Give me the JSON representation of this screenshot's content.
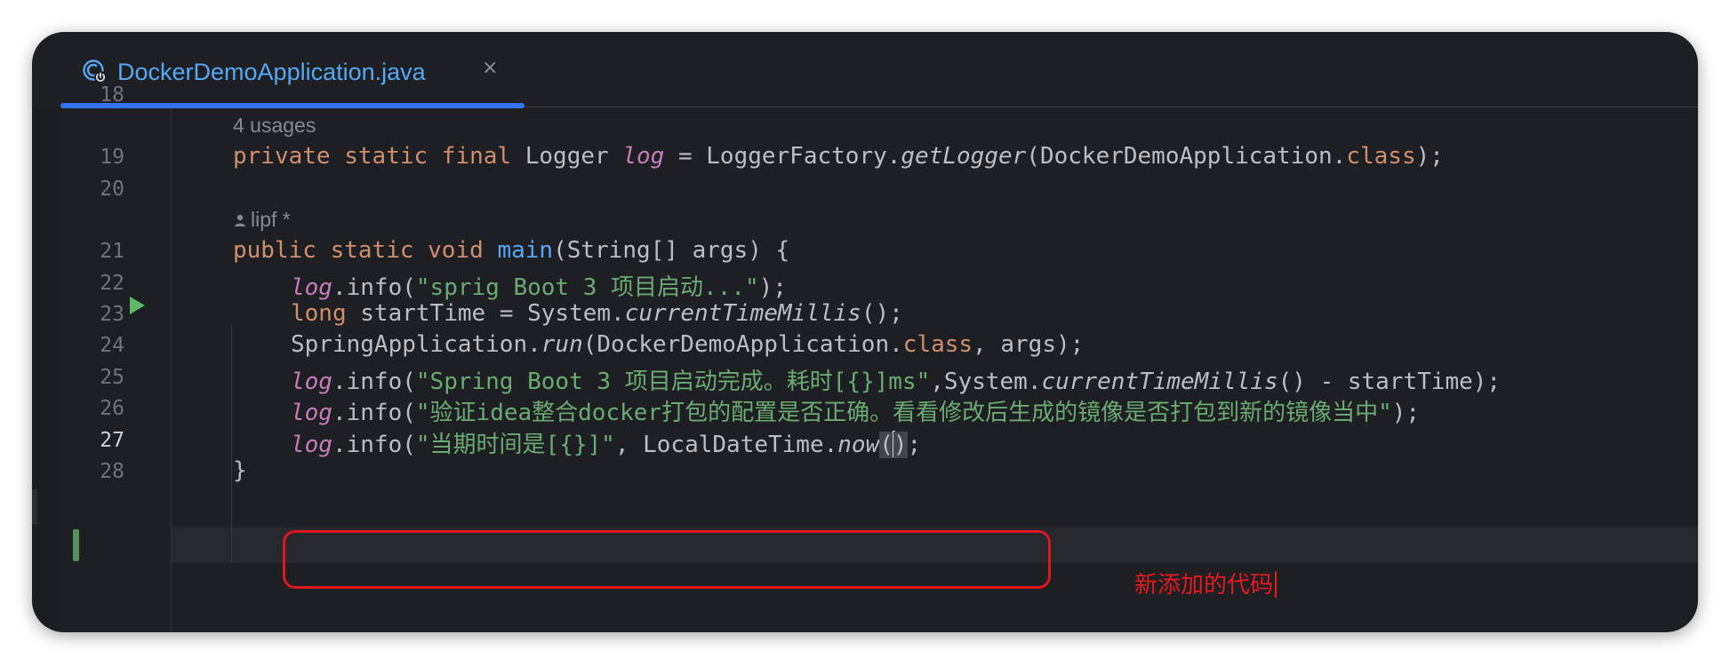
{
  "tab": {
    "label": "DockerDemoApplication.java",
    "close": "×"
  },
  "lines": {
    "l18": "18",
    "l19": "19",
    "l20": "20",
    "l21": "21",
    "l22": "22",
    "l23": "23",
    "l24": "24",
    "l25": "25",
    "l26": "26",
    "l27": "27",
    "l28": "28"
  },
  "hints": {
    "usages": "4 usages",
    "author": "lipf *"
  },
  "code": {
    "l19": {
      "private": "private",
      "static": "static",
      "final": "final",
      "type": " Logger ",
      "field": "log",
      "assign": " = LoggerFactory.",
      "method": "getLogger",
      "arg": "(DockerDemoApplication.",
      "cls": "class",
      "end": ");"
    },
    "l21": {
      "public": "public",
      "static": "static",
      "void": "void",
      "name": "main",
      "params": "(String[] args) {"
    },
    "l22": {
      "field": "log",
      "call": ".info(",
      "str": "\"sprig Boot 3 项目启动...\"",
      "end": ");"
    },
    "l23": {
      "long": "long",
      "decl": " startTime = System.",
      "method": "currentTimeMillis",
      "end": "();"
    },
    "l24": {
      "cls": "SpringApplication.",
      "method": "run",
      "arg": "(DockerDemoApplication.",
      "kw": "class",
      "end": ", args);"
    },
    "l25": {
      "field": "log",
      "call": ".info(",
      "str": "\"Spring Boot 3 项目启动完成。耗时[{}]ms\"",
      "mid": ",System.",
      "method": "currentTimeMillis",
      "end": "() - startTime);"
    },
    "l26": {
      "field": "log",
      "call": ".info(",
      "str": "\"验证idea整合docker打包的配置是否正确。看看修改后生成的镜像是否打包到新的镜像当中\"",
      "end": ");"
    },
    "l27": {
      "field": "log",
      "call": ".info(",
      "str": "\"当期时间是[{}]\"",
      "mid": ", LocalDateTime.",
      "method": "now",
      "p1": "(",
      "p2": ")",
      "end": ";"
    },
    "l28": {
      "brace": "}"
    }
  },
  "annotation": {
    "text": "新添加的代码"
  },
  "colors": {
    "background": "#1e1f22",
    "keyword": "#cf8e6d",
    "string": "#6aab73",
    "field": "#c77dbb",
    "function": "#56a8f5",
    "annotation": "#e8191f",
    "tab_accent": "#3574f0"
  },
  "icons": {
    "tab": "java-class-run-icon",
    "close": "close-icon",
    "run": "run-gutter-icon",
    "author": "user-icon"
  }
}
